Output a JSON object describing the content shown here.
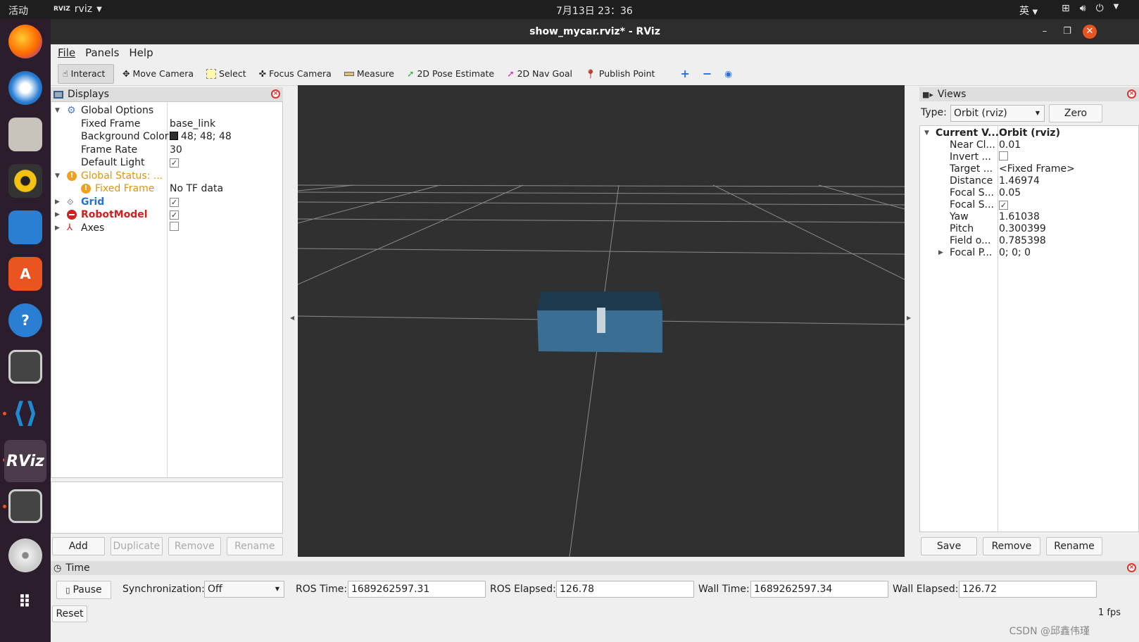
{
  "topbar": {
    "activities": "活动",
    "app_name": "rviz",
    "app_badge": "RVIZ",
    "clock": "7月13日 23：36",
    "ime": "英"
  },
  "window": {
    "title": "show_mycar.rviz* - RViz"
  },
  "menu": {
    "file": "File",
    "panels": "Panels",
    "help": "Help"
  },
  "toolbar": {
    "interact": "Interact",
    "move_camera": "Move Camera",
    "select": "Select",
    "focus_camera": "Focus Camera",
    "measure": "Measure",
    "pose_estimate": "2D Pose Estimate",
    "nav_goal": "2D Nav Goal",
    "publish_point": "Publish Point"
  },
  "displays": {
    "title": "Displays",
    "global_options": "Global Options",
    "fixed_frame_label": "Fixed Frame",
    "fixed_frame_value": "base_link",
    "bg_color_label": "Background Color",
    "bg_color_value": "48; 48; 48",
    "frame_rate_label": "Frame Rate",
    "frame_rate_value": "30",
    "default_light_label": "Default Light",
    "global_status": "Global Status: ...",
    "status_fixed_frame": "Fixed Frame",
    "status_fixed_frame_value": "No TF data",
    "grid": "Grid",
    "robot_model": "RobotModel",
    "axes": "Axes",
    "buttons": {
      "add": "Add",
      "duplicate": "Duplicate",
      "remove": "Remove",
      "rename": "Rename"
    }
  },
  "views": {
    "title": "Views",
    "type_label": "Type:",
    "type_value": "Orbit (rviz)",
    "zero": "Zero",
    "current_view_label": "Current V...",
    "current_view_value": "Orbit (rviz)",
    "properties": [
      {
        "label": "Near Cl...",
        "value": "0.01"
      },
      {
        "label": "Invert ...",
        "value": ""
      },
      {
        "label": "Target ...",
        "value": "<Fixed Frame>"
      },
      {
        "label": "Distance",
        "value": "1.46974"
      },
      {
        "label": "Focal S...",
        "value": "0.05"
      },
      {
        "label": "Focal S...",
        "value": ""
      },
      {
        "label": "Yaw",
        "value": "1.61038"
      },
      {
        "label": "Pitch",
        "value": "0.300399"
      },
      {
        "label": "Field o...",
        "value": "0.785398"
      },
      {
        "label": "Focal P...",
        "value": "0; 0; 0"
      }
    ],
    "buttons": {
      "save": "Save",
      "remove": "Remove",
      "rename": "Rename"
    }
  },
  "time": {
    "title": "Time",
    "pause": "Pause",
    "sync_label": "Synchronization:",
    "sync_value": "Off",
    "ros_time_label": "ROS Time:",
    "ros_time_value": "1689262597.31",
    "ros_elapsed_label": "ROS Elapsed:",
    "ros_elapsed_value": "126.78",
    "wall_time_label": "Wall Time:",
    "wall_time_value": "1689262597.34",
    "wall_elapsed_label": "Wall Elapsed:",
    "wall_elapsed_value": "126.72",
    "reset": "Reset",
    "fps": "1 fps"
  },
  "watermark": "CSDN @邱鑫伟瑾",
  "colors": {
    "viewport_bg": "#303030",
    "car_body": "#3a6f93",
    "accent": "#e95420"
  }
}
